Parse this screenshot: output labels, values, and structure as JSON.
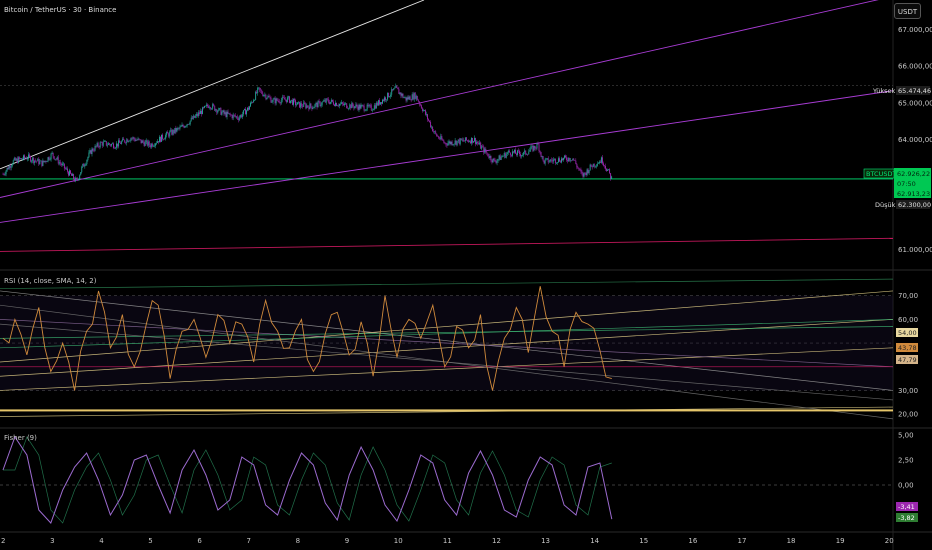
{
  "header": {
    "symbol_title": "Bitcoin / TetherUS · 30 · Binance",
    "currency_button": "USDT"
  },
  "colors": {
    "background": "#000000",
    "up": "#26a69a",
    "down": "#9c27b0",
    "price_line": "#00e676",
    "rsi_line": "#d08a3c",
    "fisher_line": "#9c6bd0",
    "trend_purple": "#a83cd4",
    "trend_red": "#c2185b",
    "trend_white": "#e6e6e6"
  },
  "chart_data": [
    {
      "type": "candlestick",
      "panel": "price",
      "y_ticks": [
        "67.000,00",
        "66.000,00",
        "65.000,00",
        "64.000,00",
        "61.000,00"
      ],
      "ylim": [
        60500,
        67800
      ],
      "x_ticks": [
        "2",
        "3",
        "4",
        "5",
        "6",
        "7",
        "8",
        "9",
        "10",
        "11",
        "12",
        "13",
        "14",
        "15",
        "16",
        "17",
        "18",
        "19",
        "20"
      ],
      "close_path": [
        [
          2.0,
          63060
        ],
        [
          2.2,
          63400
        ],
        [
          2.5,
          63520
        ],
        [
          2.8,
          63350
        ],
        [
          3.0,
          63600
        ],
        [
          3.3,
          63150
        ],
        [
          3.5,
          62850
        ],
        [
          3.6,
          63200
        ],
        [
          3.8,
          63700
        ],
        [
          4.0,
          63900
        ],
        [
          4.3,
          63850
        ],
        [
          4.6,
          64050
        ],
        [
          5.0,
          63850
        ],
        [
          5.3,
          64100
        ],
        [
          5.6,
          64300
        ],
        [
          5.9,
          64600
        ],
        [
          6.2,
          64950
        ],
        [
          6.5,
          64700
        ],
        [
          6.8,
          64600
        ],
        [
          7.0,
          64850
        ],
        [
          7.2,
          65350
        ],
        [
          7.5,
          65050
        ],
        [
          7.8,
          65100
        ],
        [
          8.0,
          64950
        ],
        [
          8.3,
          64900
        ],
        [
          8.6,
          65050
        ],
        [
          8.9,
          64950
        ],
        [
          9.2,
          64900
        ],
        [
          9.5,
          64850
        ],
        [
          9.8,
          65150
        ],
        [
          10.0,
          65380
        ],
        [
          10.2,
          65100
        ],
        [
          10.4,
          65200
        ],
        [
          10.6,
          64700
        ],
        [
          10.8,
          64150
        ],
        [
          11.0,
          63900
        ],
        [
          11.3,
          63950
        ],
        [
          11.6,
          64000
        ],
        [
          11.8,
          63700
        ],
        [
          12.0,
          63400
        ],
        [
          12.3,
          63650
        ],
        [
          12.6,
          63600
        ],
        [
          12.9,
          63850
        ],
        [
          13.0,
          63400
        ],
        [
          13.3,
          63450
        ],
        [
          13.6,
          63500
        ],
        [
          13.8,
          63000
        ],
        [
          14.0,
          63300
        ],
        [
          14.2,
          63450
        ],
        [
          14.4,
          62930
        ]
      ],
      "current_price": "62.926,22",
      "countdown": "07:50",
      "bid_price": "62.913,23",
      "high": {
        "label": "Yüksek",
        "value": "65.474,46",
        "price": 65474.46
      },
      "low": {
        "label": "Düşük",
        "value": "62.300,00",
        "price": 62300
      },
      "pair_tag": "BTCUSDT"
    },
    {
      "type": "line",
      "panel": "rsi",
      "title": "RSI (14, close, SMA, 14, 2)",
      "y_ticks": [
        "70,00",
        "60,00",
        "30,00",
        "20,00"
      ],
      "ylim": [
        15,
        80
      ],
      "badges": [
        {
          "value": "54,00",
          "color": "#e8d8a0"
        },
        {
          "value": "47,79",
          "color": "#d4b48a"
        },
        {
          "value": "43,78",
          "color": "#d08a3c"
        }
      ],
      "series": [
        {
          "values": [
            52,
            60,
            45,
            65,
            38,
            50,
            30,
            55,
            72,
            48,
            62,
            40,
            58,
            66,
            35,
            55,
            60,
            44,
            62,
            50,
            58,
            42,
            68,
            55,
            48,
            60,
            38,
            54,
            63,
            45,
            59,
            36,
            70,
            44,
            60,
            52,
            66,
            40,
            57,
            48,
            62,
            30,
            52,
            65,
            46,
            74,
            55,
            40,
            63,
            58,
            47,
            35
          ]
        }
      ]
    },
    {
      "type": "line",
      "panel": "fisher",
      "title": "Fisher (9)",
      "y_ticks": [
        "5,00",
        "2,50",
        "0,00"
      ],
      "ylim": [
        -4.5,
        5.5
      ],
      "badges": [
        {
          "value": "-3,41",
          "color": "#9c27b0"
        },
        {
          "value": "-3,82",
          "color": "#2e7d32"
        }
      ],
      "series": [
        {
          "values": [
            1.5,
            4.8,
            3.0,
            -2.5,
            -3.8,
            -0.5,
            1.8,
            3.2,
            0.5,
            -3.0,
            -1.0,
            2.5,
            3.0,
            0.0,
            -2.8,
            1.5,
            3.5,
            1.0,
            -2.5,
            -1.5,
            2.8,
            2.0,
            -2.0,
            -3.0,
            0.5,
            3.2,
            2.0,
            -1.8,
            -3.5,
            1.0,
            3.8,
            1.5,
            -2.0,
            -3.6,
            -0.5,
            3.0,
            2.2,
            -1.5,
            -3.0,
            1.2,
            3.4,
            1.0,
            -2.5,
            -3.2,
            0.5,
            2.8,
            2.0,
            -2.0,
            -3.0,
            1.8,
            2.2,
            -3.41
          ]
        }
      ]
    }
  ]
}
